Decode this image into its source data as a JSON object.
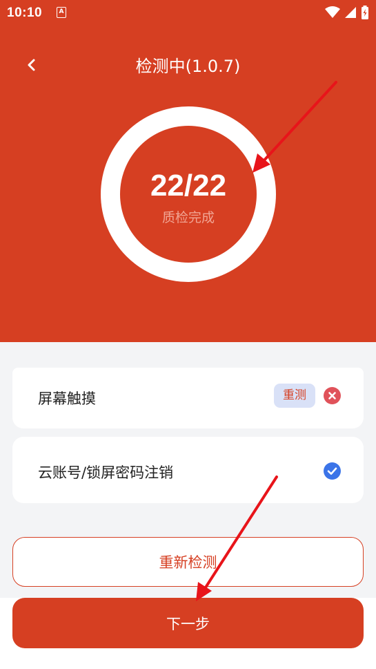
{
  "status_bar": {
    "time": "10:10",
    "app_icon_letter": "A",
    "icons": [
      "wifi-icon",
      "signal-icon",
      "battery-icon"
    ]
  },
  "header": {
    "title": "检测中(1.0.7)",
    "back_icon": "chevron-left-icon"
  },
  "progress": {
    "count": "22/22",
    "label": "质检完成",
    "completed": 22,
    "total": 22
  },
  "checks": [
    {
      "label": "屏幕触摸",
      "status": "fail",
      "action_label": "重测",
      "status_icon": "error-circle-icon"
    },
    {
      "label": "云账号/锁屏密码注销",
      "status": "pass",
      "status_icon": "check-circle-icon"
    }
  ],
  "buttons": {
    "retest_label": "重新检测",
    "next_label": "下一步"
  },
  "colors": {
    "brand": "#D63F22",
    "background": "#F3F4F6",
    "badge_bg": "#D9E1F7",
    "fail": "#E0525A",
    "pass": "#3B74E8",
    "annotation_arrow": "#E8141A"
  }
}
